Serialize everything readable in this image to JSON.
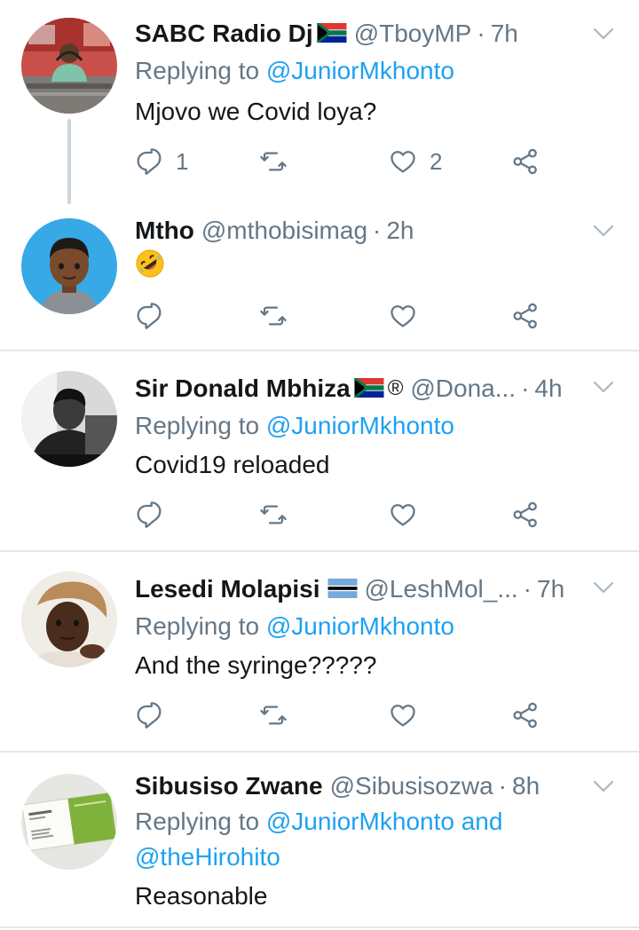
{
  "tweets": [
    {
      "name": "SABC Radio Dj",
      "flag": "south-africa-flag",
      "handle": "@TboyMP",
      "dot": "·",
      "time": "7h",
      "reply_prefix": "Replying to ",
      "reply_users": "@JuniorMkhonto",
      "text": "Mjovo we Covid loya?",
      "reply_count": "1",
      "retweet_count": "",
      "like_count": "2"
    },
    {
      "name": "Mtho",
      "handle": "@mthobisimag",
      "dot": "·",
      "time": "2h",
      "emoji": "rolling-on-the-floor-laughing-emoji",
      "reply_count": "",
      "retweet_count": "",
      "like_count": ""
    },
    {
      "name": "Sir Donald Mbhiza",
      "flag": "south-africa-flag",
      "reg": "®",
      "handle": "@Dona...",
      "dot": "·",
      "time": "4h",
      "reply_prefix": "Replying to ",
      "reply_users": "@JuniorMkhonto",
      "text": "Covid19 reloaded",
      "reply_count": "",
      "retweet_count": "",
      "like_count": ""
    },
    {
      "name": "Lesedi Molapisi",
      "flag": "botswana-flag",
      "handle": "@LeshMol_...",
      "dot": "·",
      "time": "7h",
      "reply_prefix": "Replying to ",
      "reply_users": "@JuniorMkhonto",
      "text": "And the syringe?????",
      "reply_count": "",
      "retweet_count": "",
      "like_count": ""
    },
    {
      "name": "Sibusiso Zwane",
      "handle": "@Sibusisozwa",
      "dot": "·",
      "time": "8h",
      "reply_prefix": "Replying to ",
      "reply_users_line1": "@JuniorMkhonto and",
      "reply_users_line2": "@theHirohito",
      "text": "Reasonable"
    }
  ],
  "icons": {
    "reply": "reply-icon",
    "retweet": "retweet-icon",
    "like": "heart-icon",
    "share": "share-icon",
    "more": "chevron-down-icon"
  },
  "colors": {
    "text": "#14171a",
    "secondary": "#657786",
    "link": "#1da1f2",
    "divider": "#e1e8ed"
  }
}
